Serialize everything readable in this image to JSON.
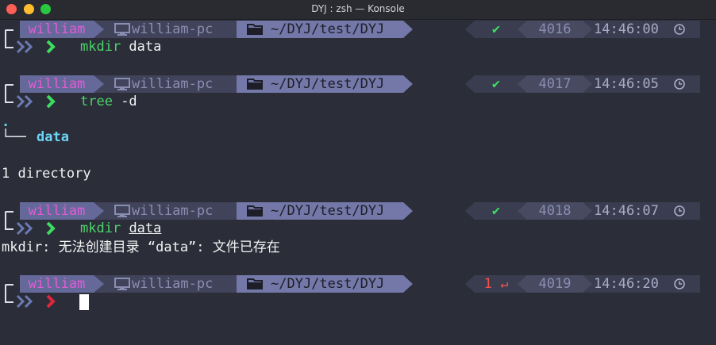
{
  "window": {
    "title": "DYJ : zsh — Konsole"
  },
  "colors": {
    "ok": "#3ddc60",
    "error": "#f1504d",
    "user": "#e25bd6",
    "command": "#4bd36a",
    "directory": "#6ed4f5"
  },
  "prompts": [
    {
      "user": "william",
      "host": "william-pc",
      "path": "~/DYJ/test/DYJ",
      "status": "✔",
      "number": "4016",
      "time": "14:46:00",
      "cmd": "mkdir",
      "args": " data"
    },
    {
      "user": "william",
      "host": "william-pc",
      "path": "~/DYJ/test/DYJ",
      "status": "✔",
      "number": "4017",
      "time": "14:46:05",
      "cmd": "tree",
      "args": " -d"
    },
    {
      "user": "william",
      "host": "william-pc",
      "path": "~/DYJ/test/DYJ",
      "status": "✔",
      "number": "4018",
      "time": "14:46:07",
      "cmd": "mkdir",
      "args": "data"
    },
    {
      "user": "william",
      "host": "william-pc",
      "path": "~/DYJ/test/DYJ",
      "status": "1 ↵",
      "number": "4019",
      "time": "14:46:20",
      "cmd": "",
      "args": ""
    }
  ],
  "output": {
    "tree_root": ".",
    "tree_branch": "└──",
    "tree_item": "data",
    "tree_summary": "1 directory",
    "error_line": "mkdir: 无法创建目录 “data”: 文件已存在"
  },
  "icons": {
    "host": "monitor-icon",
    "path": "folder-icon",
    "time": "clock-icon",
    "prompt": "chevron-icon"
  }
}
